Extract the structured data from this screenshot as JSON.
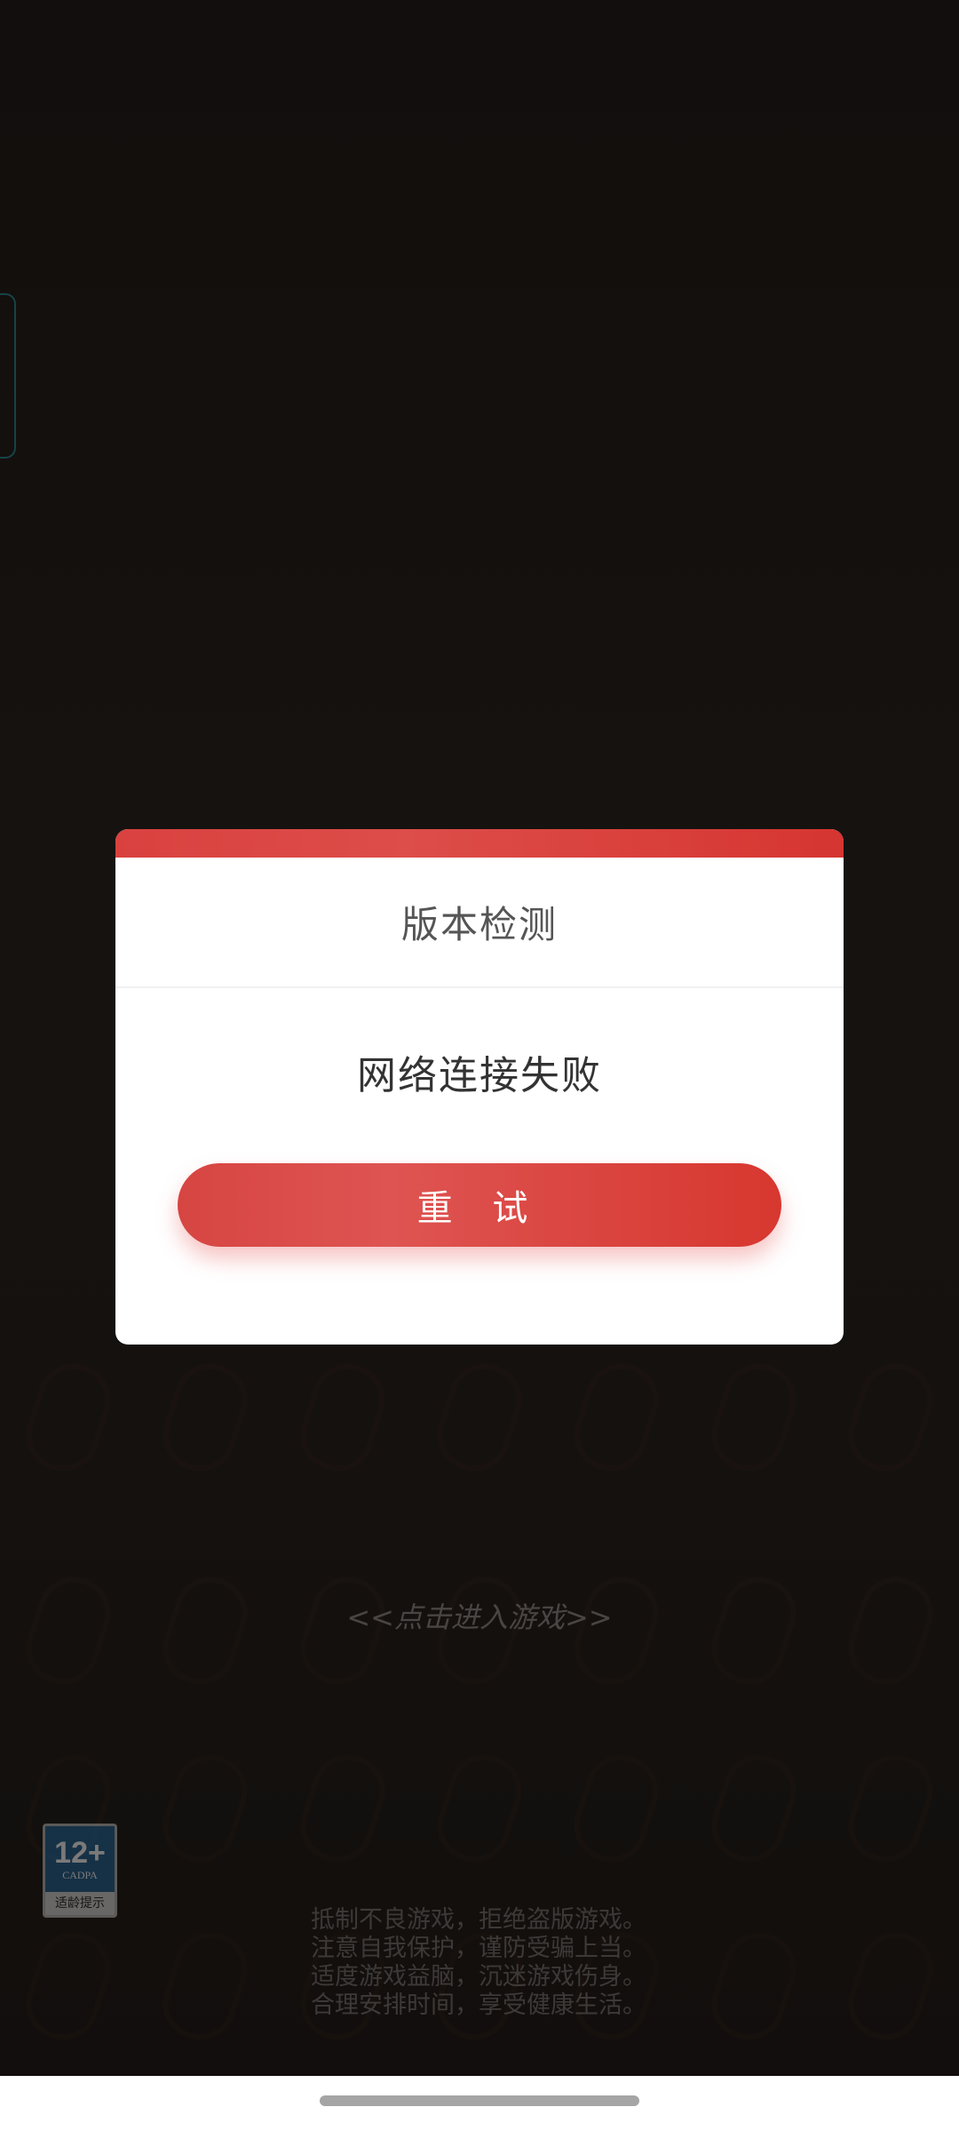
{
  "dialog": {
    "title": "版本检测",
    "message": "网络连接失败",
    "retry_label": "重 试"
  },
  "enter_game": {
    "label": "<<点击进入游戏>>"
  },
  "age_rating": {
    "number": "12+",
    "org": "CADPA",
    "tip": "适龄提示"
  },
  "health_notice": {
    "lines": [
      "抵制不良游戏，拒绝盗版游戏。",
      "注意自我保护，谨防受骗上当。",
      "适度游戏益脑，沉迷游戏伤身。",
      "合理安排时间，享受健康生活。"
    ]
  },
  "colors": {
    "accent_red": "#d9413f",
    "background": "#171312"
  }
}
